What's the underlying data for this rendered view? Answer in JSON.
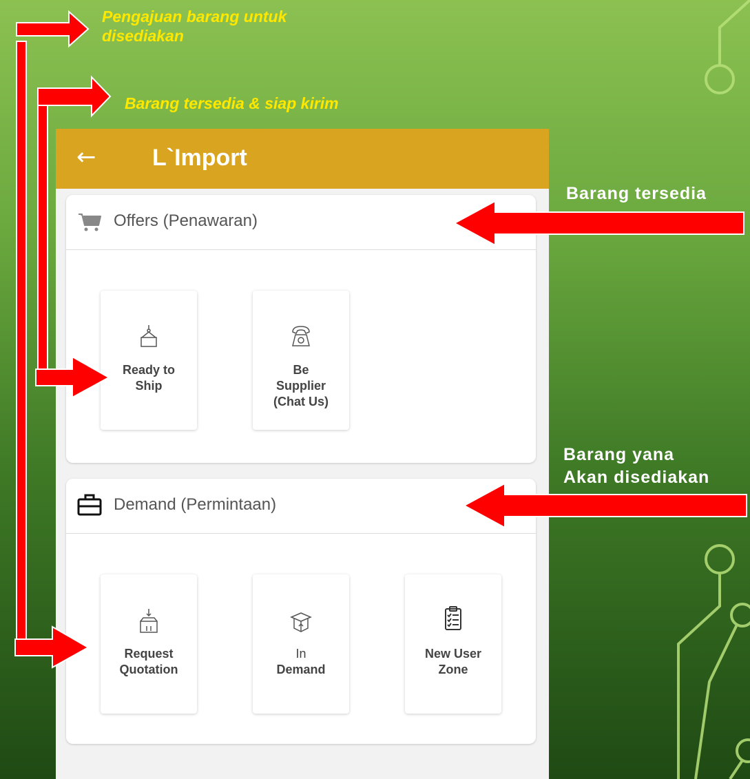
{
  "colors": {
    "appbar": "#d9a420",
    "arrow": "#ff0000",
    "annotation_yellow": "#ffe800"
  },
  "app": {
    "back_icon": "arrow-left-icon",
    "title": "L`Import"
  },
  "offers": {
    "header_icon": "shopping-cart-icon",
    "header": "Offers (Penawaran)",
    "tiles": [
      {
        "icon": "crate-hook-icon",
        "label_line1": "Ready to",
        "label_line2": "Ship"
      },
      {
        "icon": "phone-icon",
        "label_line1": "Be",
        "label_line2": "Supplier",
        "label_line3": "(Chat Us)"
      }
    ]
  },
  "demand": {
    "header_icon": "briefcase-icon",
    "header": "Demand (Permintaan)",
    "tiles": [
      {
        "icon": "box-arrow-down-icon",
        "label_line1": "Request",
        "label_line2": "Quotation"
      },
      {
        "icon": "open-box-icon",
        "label_line1": "In",
        "label_line2": "Demand"
      },
      {
        "icon": "clipboard-checklist-icon",
        "label_line1": "New User",
        "label_line2": "Zone"
      }
    ]
  },
  "annotations": {
    "pengajuan_line1": "Pengajuan barang untuk",
    "pengajuan_line2": "disediakan",
    "siap_kirim": "Barang tersedia & siap kirim",
    "barang_tersedia": "Barang tersedia",
    "akan_line1": "Barang yana",
    "akan_line2": "Akan disediakan"
  }
}
